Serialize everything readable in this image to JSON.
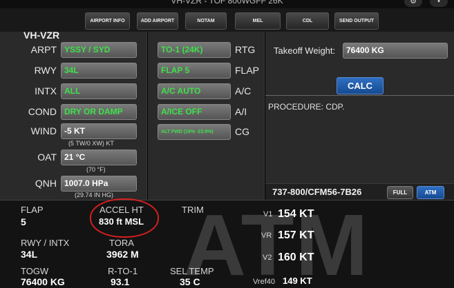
{
  "header": {
    "title": "VH-VZR - TOF 800WGFF 26K"
  },
  "toolbar": {
    "buttons": [
      "AIRPORT INFO",
      "ADD AIRPORT",
      "NOTAM",
      "MEL",
      "CDL",
      "SEND OUTPUT"
    ]
  },
  "left": {
    "registration": "VH-VZR",
    "arpt": {
      "label": "ARPT",
      "value": "YSSY / SYD"
    },
    "rwy": {
      "label": "RWY",
      "value": "34L"
    },
    "intx": {
      "label": "INTX",
      "value": "ALL"
    },
    "cond": {
      "label": "COND",
      "value": "DRY OR DAMP"
    },
    "wind": {
      "label": "WIND",
      "value": "-5 KT",
      "sub": "(5 TW/0 XW) KT"
    },
    "oat": {
      "label": "OAT",
      "value": "21 °C",
      "sub": "(70 °F)"
    },
    "qnh": {
      "label": "QNH",
      "value": "1007.0 HPa",
      "sub": "(29.74 IN HG)"
    }
  },
  "middle": {
    "rtg": {
      "label": "RTG",
      "value": "TO-1 (24K)"
    },
    "flap": {
      "label": "FLAP",
      "value": "FLAP 5"
    },
    "ac": {
      "label": "A/C",
      "value": "A/C AUTO"
    },
    "ai": {
      "label": "A/I",
      "value": "A/ICE OFF"
    },
    "cg": {
      "label": "CG",
      "value": "ALT FWD (16% -23.9%)"
    }
  },
  "right": {
    "tow_label": "Takeoff Weight:",
    "tow_value": "76400 KG",
    "calc": "CALC",
    "procedure": "PROCEDURE: CDP.",
    "engine": "737-800/CFM56-7B26",
    "mode_full": "FULL",
    "mode_atm": "ATM"
  },
  "results": {
    "watermark": "ATM",
    "flap": {
      "label": "FLAP",
      "value": "5"
    },
    "accel": {
      "label": "ACCEL HT",
      "value": "830 ft MSL"
    },
    "trim": {
      "label": "TRIM",
      "value": ""
    },
    "rwy_intx": {
      "label": "RWY / INTX",
      "value": "34L"
    },
    "tora": {
      "label": "TORA",
      "value": "3962 M"
    },
    "togw": {
      "label": "TOGW",
      "value": "76400 KG"
    },
    "rto1": {
      "label": "R-TO-1",
      "value": "93.1"
    },
    "sel_temp": {
      "label": "SEL TEMP",
      "value": "35 C"
    },
    "v1": {
      "label": "V1",
      "value": "154 KT"
    },
    "vr": {
      "label": "VR",
      "value": "157 KT"
    },
    "v2": {
      "label": "V2",
      "value": "160 KT"
    },
    "vref": {
      "label": "Vref40",
      "value": "149 KT"
    }
  },
  "colors": {
    "entry_green": "#3fe04a",
    "accent_blue": "#1f5faf",
    "annotation_red": "#d81e1e"
  }
}
